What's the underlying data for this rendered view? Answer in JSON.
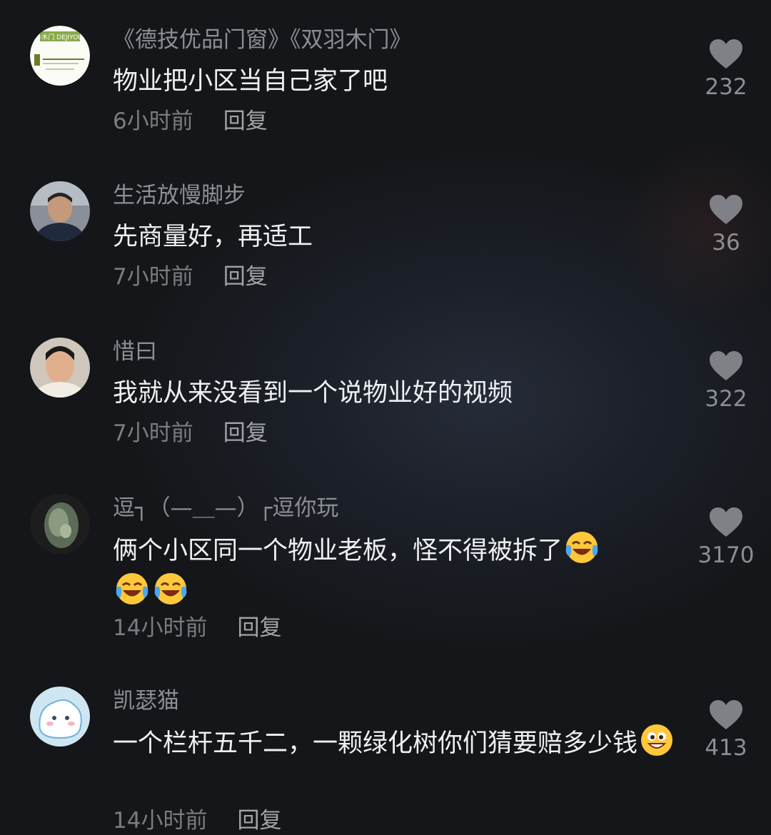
{
  "comments": [
    {
      "username": "《德技优品门窗》《双羽木门》",
      "avatar": "brand-logo-avatar",
      "avatar_text": "双羽·木门 DEJIYOUPIN",
      "text": "物业把小区当自己家了吧",
      "emoji_after": 0,
      "emoji_line2": 0,
      "time": "6小时前",
      "reply": "回复",
      "likes": "232"
    },
    {
      "username": "生活放慢脚步",
      "avatar": "man-photo-avatar",
      "text": "先商量好，再适工",
      "emoji_after": 0,
      "emoji_line2": 0,
      "time": "7小时前",
      "reply": "回复",
      "likes": "36"
    },
    {
      "username": "惜曰",
      "avatar": "young-man-photo-avatar",
      "text": "我就从来没看到一个说物业好的视频",
      "emoji_after": 0,
      "emoji_line2": 0,
      "time": "7小时前",
      "reply": "回复",
      "likes": "322"
    },
    {
      "username": "逗┐（—＿—）┌逗你玩",
      "avatar": "jade-photo-avatar",
      "text": "俩个小区同一个物业老板，怪不得被拆了",
      "emoji": "laughing-crying-emoji",
      "emoji_after": 1,
      "emoji_line2": 2,
      "time": "14小时前",
      "reply": "回复",
      "likes": "3170"
    },
    {
      "username": "凯瑟猫",
      "avatar": "cartoon-blob-avatar",
      "text": "一个栏杆五千二，一颗绿化树你们猜要赔多少钱",
      "emoji": "grinning-emoji",
      "emoji_after": 1,
      "emoji_line2": 0,
      "time": "14小时前",
      "reply": "回复",
      "likes": "413"
    }
  ],
  "colors": {
    "username": "#8c8e93",
    "content": "#eef0f2",
    "meta": "#7a7c80",
    "heart": "#7f8186"
  },
  "icons": {
    "like": "heart-icon"
  }
}
